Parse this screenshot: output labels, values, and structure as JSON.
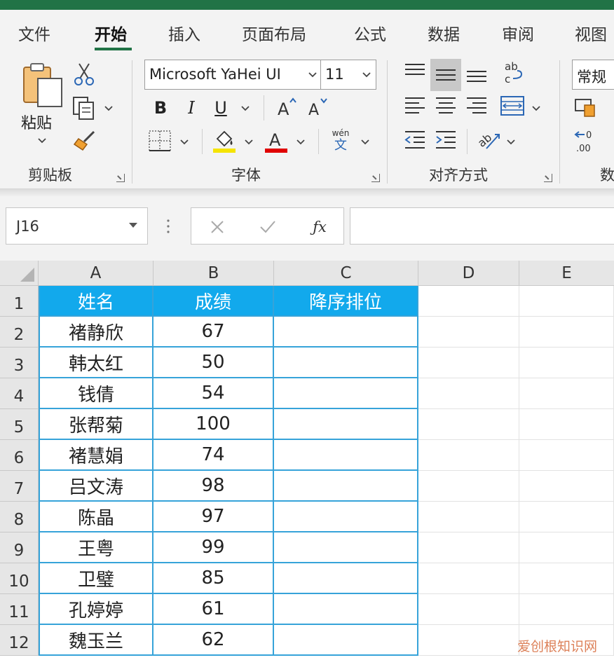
{
  "tabs": [
    {
      "label": "文件",
      "active": false
    },
    {
      "label": "开始",
      "active": true
    },
    {
      "label": "插入",
      "active": false
    },
    {
      "label": "页面布局",
      "active": false
    },
    {
      "label": "公式",
      "active": false
    },
    {
      "label": "数据",
      "active": false
    },
    {
      "label": "审阅",
      "active": false
    },
    {
      "label": "视图",
      "active": false
    }
  ],
  "ribbon": {
    "clipboard": {
      "group_label": "剪贴板",
      "paste_label": "粘贴"
    },
    "font": {
      "group_label": "字体",
      "font_name": "Microsoft YaHei UI",
      "font_size": "11",
      "highlight_color": "#f5e400",
      "font_color": "#e00000",
      "phonetic_top": "wén",
      "phonetic_bottom": "文"
    },
    "alignment": {
      "group_label": "对齐方式"
    },
    "number": {
      "group_label": "数",
      "format": "常规"
    }
  },
  "formula_bar": {
    "name_box": "J16",
    "formula": ""
  },
  "sheet": {
    "columns": [
      "A",
      "B",
      "C",
      "D",
      "E"
    ],
    "rows": [
      "1",
      "2",
      "3",
      "4",
      "5",
      "6",
      "7",
      "8",
      "9",
      "10",
      "11",
      "12"
    ],
    "headers": [
      "姓名",
      "成绩",
      "降序排位"
    ],
    "data": [
      {
        "name": "褚静欣",
        "score": "67"
      },
      {
        "name": "韩太红",
        "score": "50"
      },
      {
        "name": "钱倩",
        "score": "54"
      },
      {
        "name": "张帮菊",
        "score": "100"
      },
      {
        "name": "褚慧娟",
        "score": "74"
      },
      {
        "name": "吕文涛",
        "score": "98"
      },
      {
        "name": "陈晶",
        "score": "97"
      },
      {
        "name": "王粤",
        "score": "99"
      },
      {
        "name": "卫璧",
        "score": "85"
      },
      {
        "name": "孔婷婷",
        "score": "61"
      },
      {
        "name": "魏玉兰",
        "score": "62"
      }
    ]
  },
  "colors": {
    "title_bar": "#217346",
    "table_header_fill": "#12a9ec",
    "table_border": "#36a3d9"
  },
  "watermark": "爱创根知识网"
}
